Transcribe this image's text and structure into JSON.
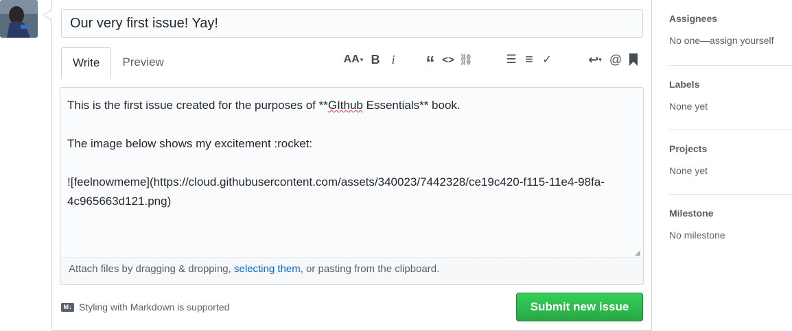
{
  "issue": {
    "title": "Our very first issue! Yay!",
    "tabs": [
      "Write",
      "Preview"
    ],
    "body_lines": [
      "This is the first issue created for the purposes of **",
      "GIthub",
      " Essentials** book.",
      "The image below shows my excitement :rocket:",
      "![feelnowmeme](https://cloud.githubusercontent.com/assets/340023/7442328/ce19c420-f115-11e4-98fa-",
      "4c965663d121.png)"
    ],
    "attach_before": "Attach files by dragging & dropping, ",
    "attach_link": "selecting them",
    "attach_after": ", or pasting from the clipboard.",
    "markdown_note": "Styling with Markdown is supported",
    "markdown_badge": "M↓",
    "submit_label": "Submit new issue"
  },
  "toolbar": {
    "header": "AA",
    "bold": "B",
    "italic": "i",
    "quote": "“",
    "code": "<>",
    "link": "⛓",
    "unordered_list": "☰",
    "ordered_list": "≡",
    "task_list": "✓",
    "reply": "↩",
    "mention": "@",
    "saved_reply": "🔖"
  },
  "sidebar": {
    "assignees_title": "Assignees",
    "assignees_value": "No one—assign yourself",
    "labels_title": "Labels",
    "labels_value": "None yet",
    "projects_title": "Projects",
    "projects_value": "None yet",
    "milestone_title": "Milestone",
    "milestone_value": "No milestone"
  },
  "colors": {
    "accent": "#28a745",
    "link": "#0366d6",
    "border": "#d1d5da"
  }
}
